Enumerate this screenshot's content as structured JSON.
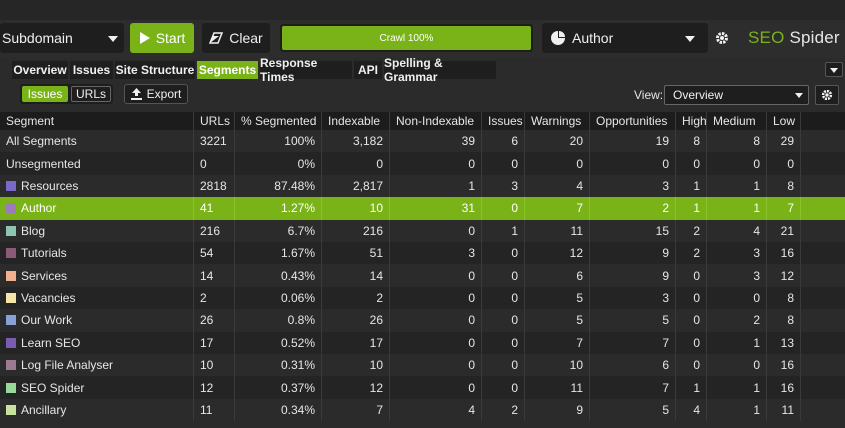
{
  "toolbar": {
    "mode": "Subdomain",
    "start_label": "Start",
    "clear_label": "Clear",
    "progress_text": "Crawl 100%",
    "progress": 1.0,
    "config": "Author",
    "logo_seo": "SEO",
    "logo_spider": "Spider"
  },
  "tabs": [
    "Overview",
    "Issues",
    "Site Structure",
    "Segments",
    "Response Times",
    "API",
    "Spelling & Grammar"
  ],
  "active_tab": "Segments",
  "subbar": {
    "issues_label": "Issues",
    "urls_label": "URLs",
    "export_label": "Export",
    "view_label": "View:",
    "view_value": "Overview"
  },
  "table": {
    "columns": [
      "Segment",
      "URLs",
      "% Segmented",
      "Indexable",
      "Non-Indexable",
      "Issues",
      "Warnings",
      "Opportunities",
      "High",
      "Medium",
      "Low"
    ],
    "rows": [
      {
        "segment": "All Segments",
        "color": null,
        "cells": [
          "3221",
          "100%",
          "3,182",
          "39",
          "6",
          "20",
          "19",
          "8",
          "8",
          "29"
        ]
      },
      {
        "segment": "Unsegmented",
        "color": null,
        "cells": [
          "0",
          "0%",
          "0",
          "0",
          "0",
          "0",
          "0",
          "0",
          "0",
          "0"
        ]
      },
      {
        "segment": "Resources",
        "color": "#7b68c8",
        "cells": [
          "2818",
          "87.48%",
          "2,817",
          "1",
          "3",
          "4",
          "3",
          "1",
          "1",
          "8"
        ]
      },
      {
        "segment": "Author",
        "color": "#9e7bbd",
        "cells": [
          "41",
          "1.27%",
          "10",
          "31",
          "0",
          "7",
          "2",
          "1",
          "1",
          "7"
        ],
        "selected": true
      },
      {
        "segment": "Blog",
        "color": "#8fc4b0",
        "cells": [
          "216",
          "6.7%",
          "216",
          "0",
          "1",
          "11",
          "15",
          "2",
          "4",
          "21"
        ]
      },
      {
        "segment": "Tutorials",
        "color": "#8c5a78",
        "cells": [
          "54",
          "1.67%",
          "51",
          "3",
          "0",
          "12",
          "9",
          "2",
          "3",
          "16"
        ]
      },
      {
        "segment": "Services",
        "color": "#f0b090",
        "cells": [
          "14",
          "0.43%",
          "14",
          "0",
          "0",
          "6",
          "9",
          "0",
          "3",
          "12"
        ]
      },
      {
        "segment": "Vacancies",
        "color": "#f5e6a8",
        "cells": [
          "2",
          "0.06%",
          "2",
          "0",
          "0",
          "5",
          "3",
          "0",
          "0",
          "8"
        ]
      },
      {
        "segment": "Our Work",
        "color": "#8aa0d8",
        "cells": [
          "26",
          "0.8%",
          "26",
          "0",
          "0",
          "5",
          "5",
          "0",
          "2",
          "8"
        ]
      },
      {
        "segment": "Learn SEO",
        "color": "#7a5cb0",
        "cells": [
          "17",
          "0.52%",
          "17",
          "0",
          "0",
          "7",
          "7",
          "0",
          "1",
          "13"
        ]
      },
      {
        "segment": "Log File Analyser",
        "color": "#9c7a92",
        "cells": [
          "10",
          "0.31%",
          "10",
          "0",
          "0",
          "10",
          "6",
          "0",
          "0",
          "16"
        ]
      },
      {
        "segment": "SEO Spider",
        "color": "#98d898",
        "cells": [
          "12",
          "0.37%",
          "12",
          "0",
          "0",
          "11",
          "7",
          "1",
          "1",
          "16"
        ]
      },
      {
        "segment": "Ancillary",
        "color": "#c8e0a0",
        "cells": [
          "11",
          "0.34%",
          "7",
          "4",
          "2",
          "9",
          "5",
          "4",
          "1",
          "11"
        ]
      }
    ]
  }
}
